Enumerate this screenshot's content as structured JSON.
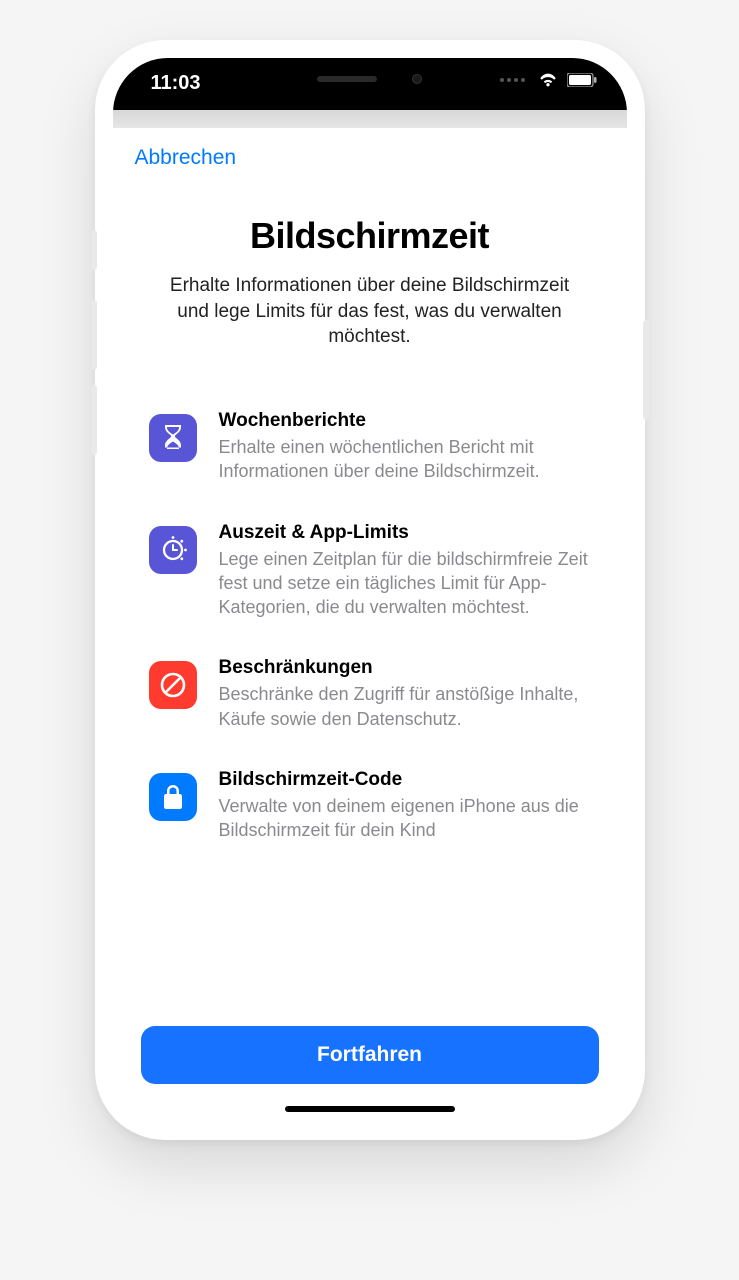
{
  "status": {
    "time": "11:03"
  },
  "sheet": {
    "cancel": "Abbrechen",
    "title": "Bildschirmzeit",
    "subtitle": "Erhalte Informationen über deine Bildschirmzeit und lege Limits für das fest, was du verwalten möchtest.",
    "continue": "Fortfahren"
  },
  "features": [
    {
      "icon": "hourglass-icon",
      "color": "purple",
      "title": "Wochenberichte",
      "body": "Erhalte einen wöchentlichen Bericht mit Informationen über deine Bildschirmzeit."
    },
    {
      "icon": "clock-dial-icon",
      "color": "purple",
      "title": "Auszeit & App-Limits",
      "body": "Lege einen Zeitplan für die bildschirmfreie Zeit fest und setze ein tägliches Limit für App-Kategorien, die du verwalten möchtest."
    },
    {
      "icon": "no-entry-icon",
      "color": "red",
      "title": "Beschränkungen",
      "body": "Beschränke den Zugriff für anstößige Inhalte, Käufe sowie den Datenschutz."
    },
    {
      "icon": "lock-icon",
      "color": "blue",
      "title": "Bildschirmzeit-Code",
      "body": "Verwalte von deinem eigenen iPhone aus die Bildschirmzeit für dein Kind"
    }
  ]
}
